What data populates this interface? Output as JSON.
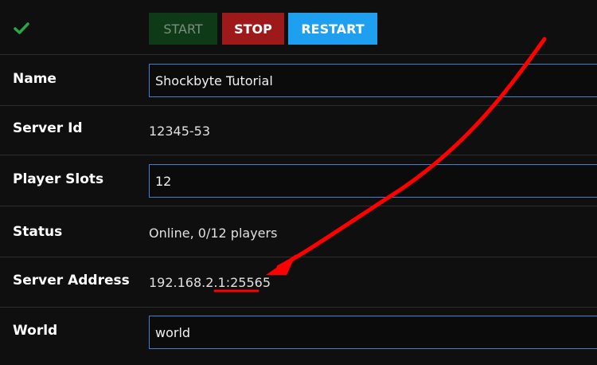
{
  "status_icon": "check-icon",
  "controls": {
    "start_label": "START",
    "stop_label": "STOP",
    "restart_label": "RESTART"
  },
  "fields": {
    "name": {
      "label": "Name",
      "value": "Shockbyte Tutorial"
    },
    "server_id": {
      "label": "Server Id",
      "value": "12345-53"
    },
    "player_slots": {
      "label": "Player Slots",
      "value": "12"
    },
    "status": {
      "label": "Status",
      "value": "Online, 0/12 players"
    },
    "server_address": {
      "label": "Server Address",
      "ip_prefix": "192.168.2.1:",
      "port": "25565"
    },
    "world": {
      "label": "World",
      "value": "world"
    }
  },
  "annotation": {
    "arrow_color": "#ff0000",
    "underline_color": "#ff0000"
  },
  "colors": {
    "accent_border": "#3f7fd1",
    "start_bg": "#0f3a18",
    "stop_bg": "#9e1a1a",
    "restart_bg": "#1e9ff0",
    "check": "#27a844"
  }
}
